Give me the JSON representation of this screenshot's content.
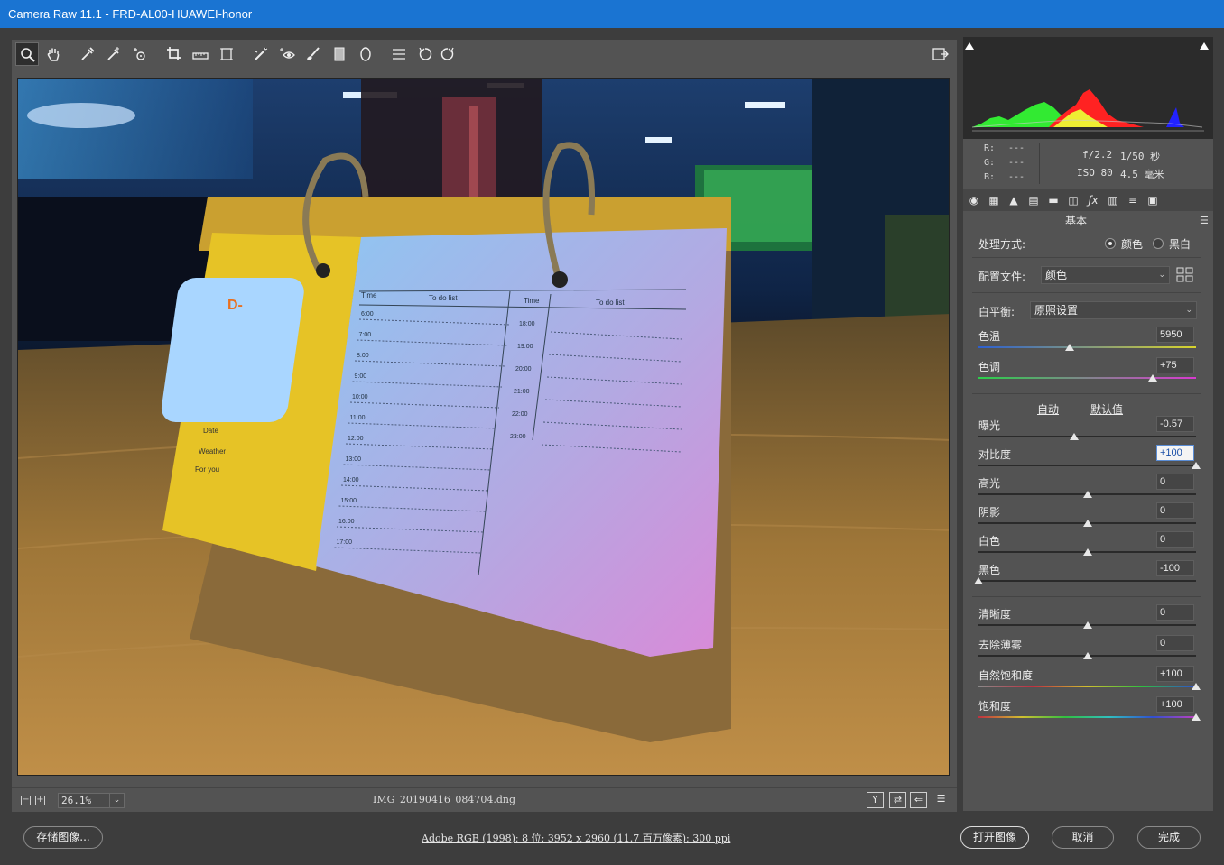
{
  "window": {
    "title": "Camera Raw 11.1 -  FRD-AL00-HUAWEI-honor"
  },
  "toolbar": {
    "tools": [
      "zoom-icon",
      "hand-icon",
      "white-balance-icon",
      "color-sampler-icon",
      "targeted-adjustment-icon",
      "crop-icon",
      "straighten-icon",
      "transform-icon",
      "spot-removal-icon",
      "red-eye-icon",
      "adjustment-brush-icon",
      "graduated-filter-icon",
      "radial-filter-icon",
      "preferences-icon",
      "rotate-left-icon",
      "rotate-right-icon"
    ],
    "fullscreen_icon": "fullscreen-icon"
  },
  "preview": {
    "calendar": {
      "badge": "D-",
      "left_col_time": "Time",
      "left_col_todo": "To do list",
      "right_col_time": "Time",
      "right_col_todo": "To do list",
      "left_times": [
        "6:00",
        "7:00",
        "8:00",
        "9:00",
        "10:00",
        "11:00",
        "12:00",
        "13:00",
        "14:00",
        "15:00",
        "16:00",
        "17:00"
      ],
      "right_times": [
        "18:00",
        "19:00",
        "20:00",
        "21:00",
        "22:00",
        "23:00"
      ],
      "date_label": "Date",
      "weather_label": "Weather",
      "foryou_label": "For you"
    }
  },
  "statusbar": {
    "zoom_value": "26.1%",
    "filename": "IMG_20190416_084704.dng"
  },
  "histogram": {
    "r_label": "R:",
    "g_label": "G:",
    "b_label": "B:",
    "r_value": "---",
    "g_value": "---",
    "b_value": "---",
    "aperture": "f/2.2",
    "shutter": "1/50 秒",
    "iso": "ISO 80",
    "focal": "4.5 毫米"
  },
  "panel": {
    "section_title": "基本",
    "treatment_label": "处理方式:",
    "treatment_color": "颜色",
    "treatment_bw": "黑白",
    "profile_label": "配置文件:",
    "profile_value": "颜色",
    "wb_label": "白平衡:",
    "wb_value": "原照设置",
    "auto_link": "自动",
    "default_link": "默认值",
    "sliders": [
      {
        "label": "色温",
        "value": "5950",
        "fraction": 0.42
      },
      {
        "label": "色调",
        "value": "+75",
        "fraction": 0.8
      },
      {
        "label": "曝光",
        "value": "-0.57",
        "fraction": 0.44
      },
      {
        "label": "对比度",
        "value": "+100",
        "fraction": 1.0
      },
      {
        "label": "高光",
        "value": "0",
        "fraction": 0.5
      },
      {
        "label": "阴影",
        "value": "0",
        "fraction": 0.5
      },
      {
        "label": "白色",
        "value": "0",
        "fraction": 0.5
      },
      {
        "label": "黑色",
        "value": "-100",
        "fraction": 0.0
      },
      {
        "label": "清晰度",
        "value": "0",
        "fraction": 0.5
      },
      {
        "label": "去除薄雾",
        "value": "0",
        "fraction": 0.5
      },
      {
        "label": "自然饱和度",
        "value": "+100",
        "fraction": 1.0
      },
      {
        "label": "饱和度",
        "value": "+100",
        "fraction": 1.0
      }
    ]
  },
  "bottom": {
    "save_label": "存储图像...",
    "workflow_text": "Adobe RGB (1998); 8 位; 3952 x 2960 (11.7 百万像素); 300 ppi",
    "open_label": "打开图像",
    "cancel_label": "取消",
    "done_label": "完成"
  },
  "colors": {
    "titlebar": "#1a74d2",
    "panel_bg": "#535353",
    "frame_bg": "#3d3d3d"
  }
}
